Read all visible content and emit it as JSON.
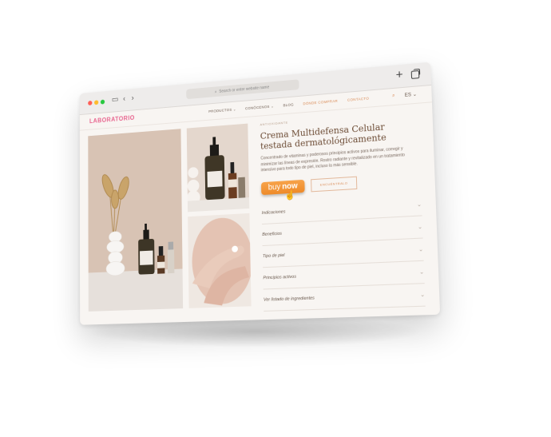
{
  "browser": {
    "url_placeholder": "Search or enter website name",
    "search_icon": "search-icon",
    "new_tab_icon": "plus-icon",
    "tabs_icon": "tabs-icon"
  },
  "site": {
    "logo": "LABORATORIO",
    "menu": [
      {
        "label": "PRODUCTOS ⌄"
      },
      {
        "label": "CONÓCENOS ⌄"
      },
      {
        "label": "BLOG"
      },
      {
        "label": "DÓNDE COMPRAR"
      },
      {
        "label": "CONTACTO"
      }
    ],
    "lang": "ES ⌄"
  },
  "product": {
    "eyebrow": "ANTIOXIDANTE",
    "title": "Crema Multidefensa Celular testada dermatológicamente",
    "description": "Concentrado de vitaminas y poderosos principios activos para iluminar, corregir y minimizar las líneas de expresión. Rostro radiante y revitalizado en un tratamiento intensivo para todo tipo de piel, incluso la más sensible.",
    "buy_label_1": "buy",
    "buy_label_2": "now",
    "find_label": "ENCUÉNTRALO"
  },
  "accordion": [
    {
      "label": "Indicaciones"
    },
    {
      "label": "Beneficios"
    },
    {
      "label": "Tipo de piel"
    },
    {
      "label": "Principios activos"
    },
    {
      "label": "Ver listado de ingredientes"
    }
  ],
  "colors": {
    "brand": "#e8658f",
    "accent": "#d98a55",
    "cta": "#f39a3a"
  }
}
